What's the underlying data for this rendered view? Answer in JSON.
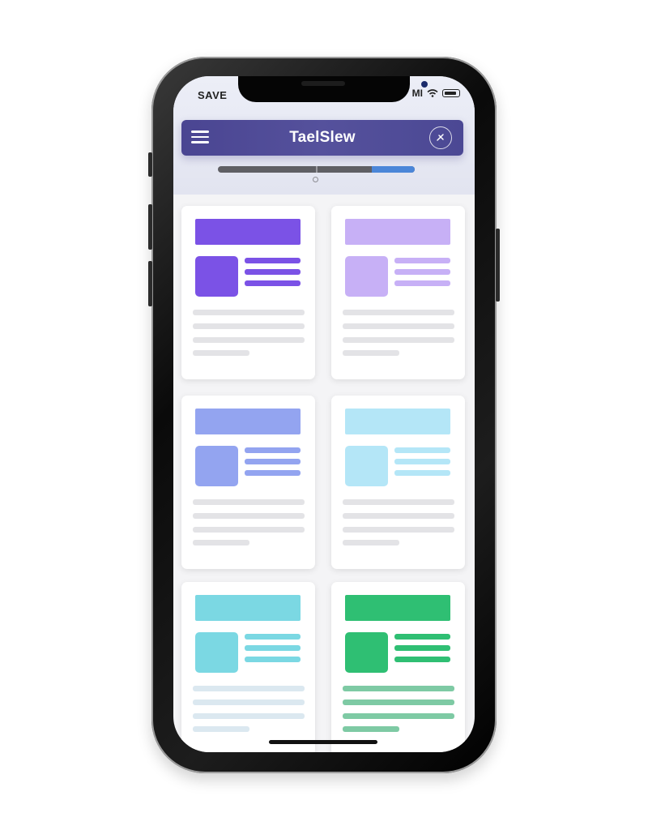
{
  "status_bar": {
    "time": "SAVE",
    "signal": "MI"
  },
  "app_bar": {
    "title": "TaelSlew"
  },
  "progress": {
    "fraction": 0.22
  },
  "cards": [
    {
      "accent": "#7b52e6",
      "line_color": "#7b52e6",
      "text_line_color": "#e3e3e6"
    },
    {
      "accent": "#c7b0f6",
      "line_color": "#c7b0f6",
      "text_line_color": "#e3e3e6"
    },
    {
      "accent": "#93a4f0",
      "line_color": "#93a4f0",
      "text_line_color": "#e3e3e6"
    },
    {
      "accent": "#b4e6f7",
      "line_color": "#b4e6f7",
      "text_line_color": "#e3e3e6"
    },
    {
      "accent": "#7bd8e3",
      "line_color": "#7bd8e3",
      "text_line_color": "#dbe8f0"
    },
    {
      "accent": "#2fbf73",
      "line_color": "#2fbf73",
      "text_line_color": "#7ecaa4"
    }
  ],
  "colors": {
    "app_bar": "#4b4894",
    "progress_track": "#5f5f64",
    "progress_fill": "#4b86d8",
    "screen_bg": "#f4f4f6"
  },
  "icons": {
    "menu": "hamburger-menu-icon",
    "user": "user-action-icon",
    "wifi": "wifi-icon",
    "battery": "battery-icon"
  }
}
